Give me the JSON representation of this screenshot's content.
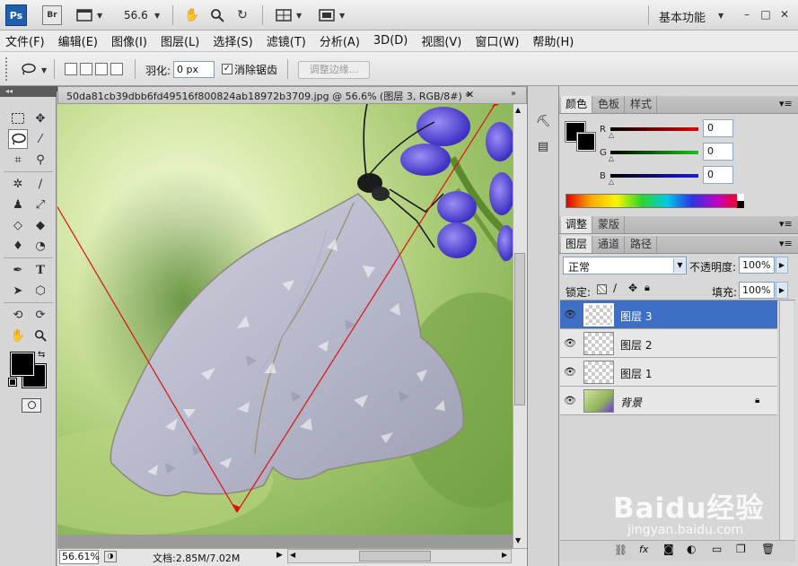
{
  "appbar": {
    "ps_logo": "Ps",
    "br_logo": "Br",
    "zoom": "56.6",
    "workspace": "基本功能"
  },
  "menubar": {
    "items": [
      "文件(F)",
      "编辑(E)",
      "图像(I)",
      "图层(L)",
      "选择(S)",
      "滤镜(T)",
      "分析(A)",
      "3D(D)",
      "视图(V)",
      "窗口(W)",
      "帮助(H)"
    ]
  },
  "options": {
    "feather_label": "羽化:",
    "feather_value": "0 px",
    "antialias_label": "消除锯齿",
    "antialias_checked": true,
    "refine_edge_label": "调整边缘..."
  },
  "document": {
    "title": "50da81cb39dbb6fd49516f800824ab18972b3709.jpg @ 56.6% (图层 3, RGB/8#) *",
    "zoom_percent": "56.61%",
    "doc_info": "文档:2.85M/7.02M"
  },
  "color_panel": {
    "tabs": [
      "颜色",
      "色板",
      "样式"
    ],
    "active_tab": "颜色",
    "r_label": "R",
    "g_label": "G",
    "b_label": "B",
    "r_value": "0",
    "g_value": "0",
    "b_value": "0",
    "foreground": "#000000",
    "background": "#000000"
  },
  "adjust_panel": {
    "tabs": [
      "调整",
      "蒙版"
    ]
  },
  "layers_panel": {
    "tabs": [
      "图层",
      "通道",
      "路径"
    ],
    "blend_mode": "正常",
    "opacity_label": "不透明度:",
    "opacity_value": "100%",
    "lock_label": "锁定:",
    "fill_label": "填充:",
    "fill_value": "100%",
    "layers": [
      {
        "name": "图层 3",
        "selected": true
      },
      {
        "name": "图层 2",
        "selected": false
      },
      {
        "name": "图层 1",
        "selected": false
      },
      {
        "name": "背景",
        "selected": false,
        "locked": true
      }
    ]
  },
  "watermark": {
    "brand": "Baidu经验",
    "url": "jingyan.baidu.com"
  },
  "colors": {
    "selected_layer": "#3e6fc4",
    "arrow_annotation": "#e01010"
  }
}
